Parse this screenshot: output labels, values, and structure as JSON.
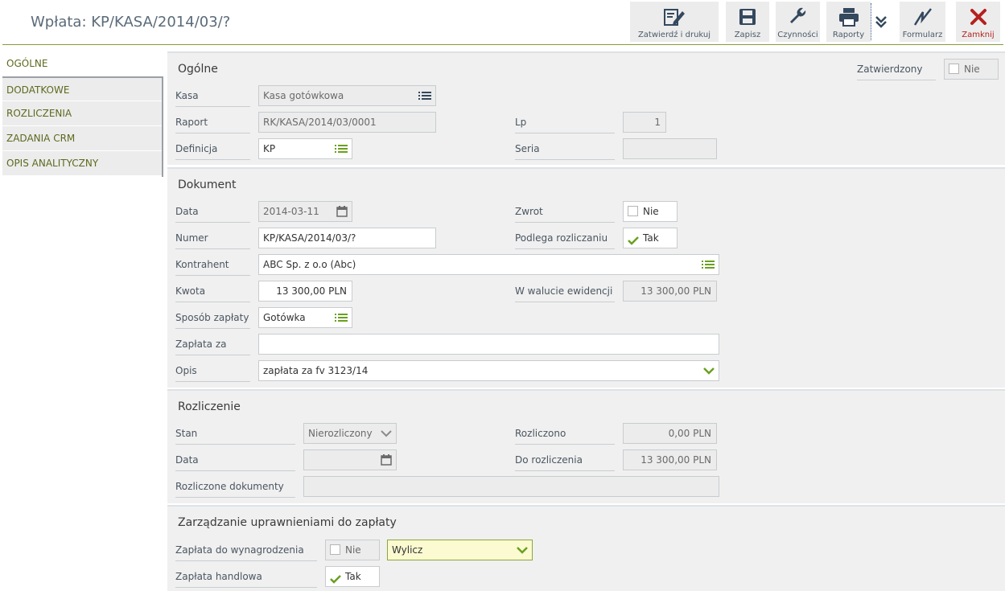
{
  "header": {
    "title": "Wpłata: KP/KASA/2014/03/?",
    "toolbar": {
      "approve_print": "Zatwierdź i drukuj",
      "save": "Zapisz",
      "actions": "Czynności",
      "reports": "Raporty",
      "form": "Formularz",
      "close": "Zamknij"
    }
  },
  "nav": {
    "items": [
      "OGÓLNE",
      "DODATKOWE",
      "ROZLICZENIA",
      "ZADANIA CRM",
      "OPIS ANALITYCZNY"
    ]
  },
  "general": {
    "title": "Ogólne",
    "approved_label": "Zatwierdzony",
    "approved_value": "Nie",
    "kasa_label": "Kasa",
    "kasa_value": "Kasa gotówkowa",
    "raport_label": "Raport",
    "raport_value": "RK/KASA/2014/03/0001",
    "lp_label": "Lp",
    "lp_value": "1",
    "definicja_label": "Definicja",
    "definicja_value": "KP",
    "seria_label": "Seria",
    "seria_value": ""
  },
  "document": {
    "title": "Dokument",
    "data_label": "Data",
    "data_value": "2014-03-11",
    "zwrot_label": "Zwrot",
    "zwrot_value": "Nie",
    "numer_label": "Numer",
    "numer_value": "KP/KASA/2014/03/?",
    "podlega_label": "Podlega rozliczaniu",
    "podlega_value": "Tak",
    "kontrahent_label": "Kontrahent",
    "kontrahent_value": "ABC Sp. z o.o (Abc)",
    "kwota_label": "Kwota",
    "kwota_value": "13 300,00 PLN",
    "waluta_label": "W walucie ewidencji",
    "waluta_value": "13 300,00 PLN",
    "sposob_label": "Sposób zapłaty",
    "sposob_value": "Gotówka",
    "zaplata_za_label": "Zapłata za",
    "zaplata_za_value": "",
    "opis_label": "Opis",
    "opis_value": "zapłata za fv 3123/14"
  },
  "settlement": {
    "title": "Rozliczenie",
    "stan_label": "Stan",
    "stan_value": "Nierozliczony",
    "rozliczono_label": "Rozliczono",
    "rozliczono_value": "0,00 PLN",
    "data_label": "Data",
    "data_value": "",
    "do_rozliczenia_label": "Do rozliczenia",
    "do_rozliczenia_value": "13 300,00 PLN",
    "dokumenty_label": "Rozliczone dokumenty",
    "dokumenty_value": ""
  },
  "permissions": {
    "title": "Zarządzanie uprawnieniami do zapłaty",
    "wynagrodzenie_label": "Zapłata do wynagrodzenia",
    "wynagrodzenie_value": "Nie",
    "wylicz_value": "Wylicz",
    "handlowa_label": "Zapłata handlowa",
    "handlowa_value": "Tak"
  },
  "colors": {
    "accent_green": "#8aa83a",
    "nav_text": "#5c6a1e",
    "close_red": "#b52020",
    "section_bg": "#f0f0f0"
  }
}
